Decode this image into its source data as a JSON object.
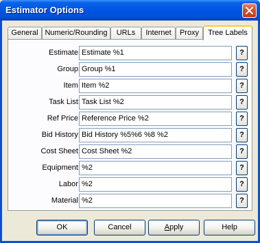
{
  "window": {
    "title": "Estimator Options"
  },
  "tabs": [
    {
      "label": "General"
    },
    {
      "label": "Numeric/Rounding"
    },
    {
      "label": "URLs"
    },
    {
      "label": "Internet"
    },
    {
      "label": "Proxy"
    },
    {
      "label": "Tree Labels"
    }
  ],
  "active_tab": "Tree Labels",
  "fields": [
    {
      "label": "Estimate:",
      "value": "Estimate %1"
    },
    {
      "label": "Group:",
      "value": "Group %1"
    },
    {
      "label": "Item:",
      "value": "Item %2"
    },
    {
      "label": "Task List:",
      "value": "Task List %2"
    },
    {
      "label": "Ref Price:",
      "value": "Reference Price %2"
    },
    {
      "label": "Bid History:",
      "value": "Bid History %5%6 %8 %2"
    },
    {
      "label": "Cost Sheet:",
      "value": "Cost Sheet %2"
    },
    {
      "label": "Equipment:",
      "value": "%2"
    },
    {
      "label": "Labor:",
      "value": "%2"
    },
    {
      "label": "Material:",
      "value": "%2"
    }
  ],
  "help_button_label": "?",
  "buttons": {
    "ok": "OK",
    "cancel": "Cancel",
    "apply_prefix": "",
    "apply_mnemonic": "A",
    "apply_rest": "pply",
    "help": "Help"
  },
  "colors": {
    "titlebar": "#0054e3",
    "active_tab_highlight": "#ffc83c",
    "close_button": "#d4502a"
  }
}
